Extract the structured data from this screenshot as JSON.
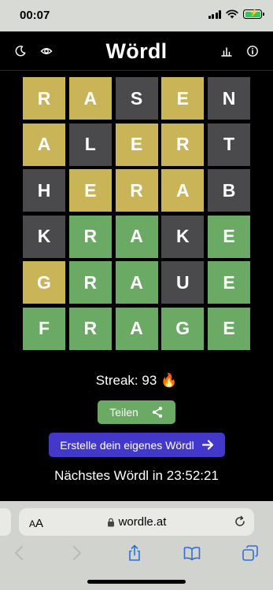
{
  "status_bar": {
    "time": "00:07"
  },
  "header": {
    "title": "Wördl",
    "icons": [
      "moon-icon",
      "eye-icon",
      "bar-chart-icon",
      "info-icon"
    ]
  },
  "board": {
    "rows": [
      [
        "R",
        "A",
        "S",
        "E",
        "N"
      ],
      [
        "A",
        "L",
        "E",
        "R",
        "T"
      ],
      [
        "H",
        "E",
        "R",
        "A",
        "B"
      ],
      [
        "K",
        "R",
        "A",
        "K",
        "E"
      ],
      [
        "G",
        "R",
        "A",
        "U",
        "E"
      ],
      [
        "F",
        "R",
        "A",
        "G",
        "E"
      ]
    ],
    "states": [
      [
        "present",
        "present",
        "absent",
        "present",
        "absent"
      ],
      [
        "present",
        "absent",
        "present",
        "present",
        "absent"
      ],
      [
        "absent",
        "present",
        "present",
        "present",
        "absent"
      ],
      [
        "absent",
        "correct",
        "correct",
        "absent",
        "correct"
      ],
      [
        "present",
        "correct",
        "correct",
        "absent",
        "correct"
      ],
      [
        "correct",
        "correct",
        "correct",
        "correct",
        "correct"
      ]
    ]
  },
  "streak": "Streak: 93 🔥",
  "share_button": {
    "label": "Teilen",
    "icon": "share-icon"
  },
  "create_button": {
    "label": "Erstelle dein eigenes Wördl",
    "icon": "arrow-right-icon"
  },
  "next_wordl": "Nächstes Wördl in 23:52:21",
  "browser": {
    "aa_small": "A",
    "aa_large": "A",
    "url": "wordle.at"
  },
  "colors": {
    "correct": "#6aaa64",
    "present": "#c9b458",
    "absent": "#4a4a4c",
    "create_button": "#4338ca",
    "background": "#000000"
  }
}
